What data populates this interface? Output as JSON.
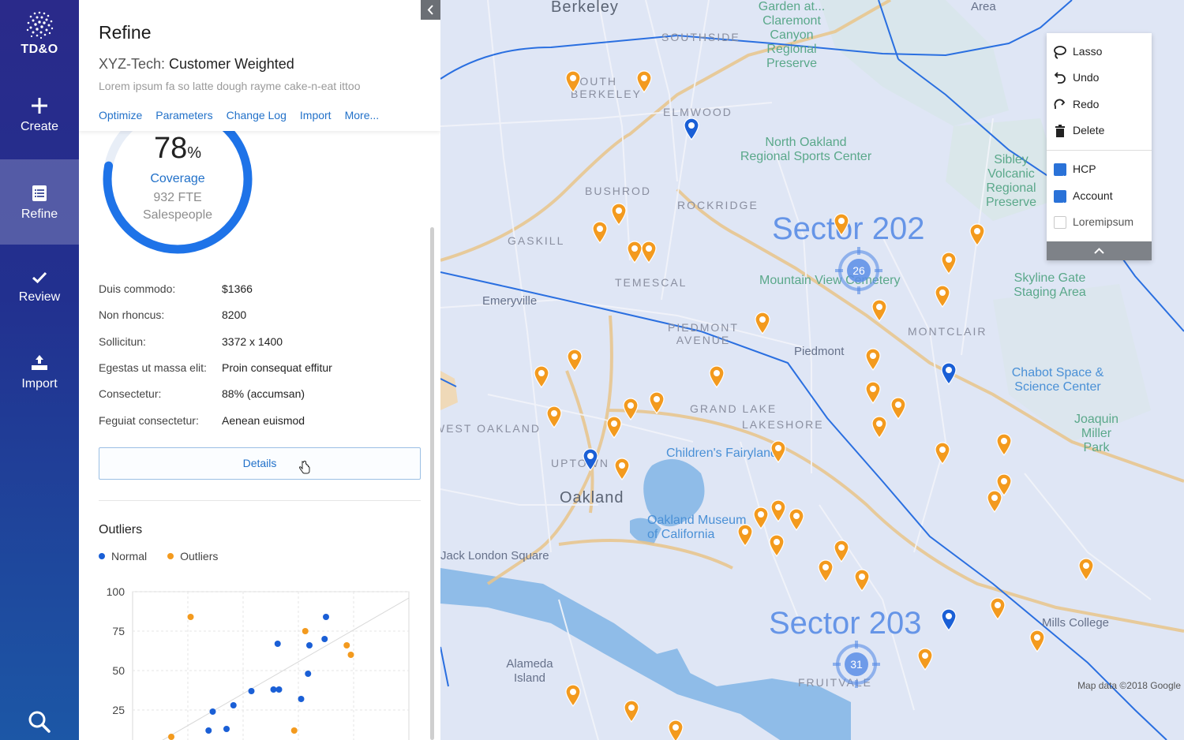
{
  "nav": {
    "logo_text": "TD&O",
    "items": [
      {
        "label": "Create"
      },
      {
        "label": "Refine"
      },
      {
        "label": "Review"
      },
      {
        "label": "Import"
      }
    ]
  },
  "panel": {
    "title": "Refine",
    "subtitle_prefix": "XYZ-Tech:",
    "subtitle_main": "Customer Weighted",
    "description": "Lorem ipsum fa so latte dough rayme cake-n-eat ittoo",
    "tabs": [
      "Optimize",
      "Parameters",
      "Change Log",
      "Import",
      "More..."
    ],
    "coverage": {
      "value": "78",
      "unit": "%",
      "fraction": 0.78,
      "label": "Coverage",
      "line2": "932 FTE",
      "line3": "Salespeople"
    },
    "stats": [
      {
        "key": "Duis commodo:",
        "value": "$1366"
      },
      {
        "key": "Non rhoncus:",
        "value": "8200"
      },
      {
        "key": "Sollicitun:",
        "value": "3372 x 1400"
      },
      {
        "key": "Egestas ut massa elit:",
        "value": "Proin consequat effitur"
      },
      {
        "key": "Consectetur:",
        "value": "88% (accumsan)"
      },
      {
        "key": "Feguiat consectetur:",
        "value": "Aenean euismod"
      }
    ],
    "details_label": "Details",
    "outliers_title": "Outliers"
  },
  "chart_data": {
    "type": "scatter",
    "title": "Outliers",
    "ylim": [
      0,
      100
    ],
    "yticks": [
      100,
      75,
      50,
      25
    ],
    "legend": "top-left",
    "grid": true,
    "series": [
      {
        "name": "Normal",
        "color": "#1a5fd6",
        "points": [
          [
            5.5,
            12
          ],
          [
            5.8,
            24
          ],
          [
            6.8,
            13
          ],
          [
            7.3,
            28
          ],
          [
            8.6,
            37
          ],
          [
            10.2,
            38
          ],
          [
            10.5,
            67
          ],
          [
            10.6,
            38
          ],
          [
            12.2,
            32
          ],
          [
            12.7,
            48
          ],
          [
            12.8,
            66
          ],
          [
            13.9,
            70
          ],
          [
            14.0,
            84
          ]
        ]
      },
      {
        "name": "Outliers",
        "color": "#f39a1e",
        "points": [
          [
            2.8,
            8
          ],
          [
            4.2,
            84
          ],
          [
            11.7,
            12
          ],
          [
            12.5,
            75
          ],
          [
            15.5,
            66
          ],
          [
            15.8,
            60
          ]
        ]
      }
    ],
    "xlim": [
      0,
      20
    ]
  },
  "map": {
    "credit": "Map data ©2018 Google",
    "sectors": [
      "Sector 202",
      "Sector 203"
    ],
    "clusters": [
      "26",
      "31"
    ],
    "districts": [
      "SOUTHSIDE",
      "SOUTH BERKELEY",
      "ELMWOOD",
      "BUSHROD",
      "ROCKRIDGE",
      "GASKILL",
      "TEMESCAL",
      "PIEDMONT AVENUE",
      "MONTCLAIR",
      "WEST OAKLAND",
      "UPTOWN",
      "GRAND LAKE",
      "LAKESHORE",
      "FRUITVALE"
    ],
    "cities": [
      "Berkeley",
      "Oakland",
      "Emeryville",
      "Piedmont",
      "Alameda Island"
    ],
    "places": [
      "Garden at... Claremont Canyon Regional Preserve",
      "North Oakland Regional Sports Center",
      "Sibley Volcanic Regional Preserve",
      "Mountain View Cemetery",
      "Skyline Gate Staging Area",
      "Chabot Space & Science Center",
      "Joaquin Miller Park",
      "Children's Fairyland",
      "Oakland Museum of California",
      "Jack London Square",
      "Mills College",
      "Area"
    ]
  },
  "tools": {
    "actions": [
      "Lasso",
      "Undo",
      "Redo",
      "Delete"
    ],
    "layers": [
      {
        "label": "HCP",
        "checked": true
      },
      {
        "label": "Account",
        "checked": true
      },
      {
        "label": "Loremipsum",
        "checked": false
      }
    ]
  },
  "colors": {
    "accent": "#2271c9",
    "orange_pin": "#f39a1e",
    "blue_pin": "#1a5fd6",
    "sector_line": "#2a6fe0"
  }
}
